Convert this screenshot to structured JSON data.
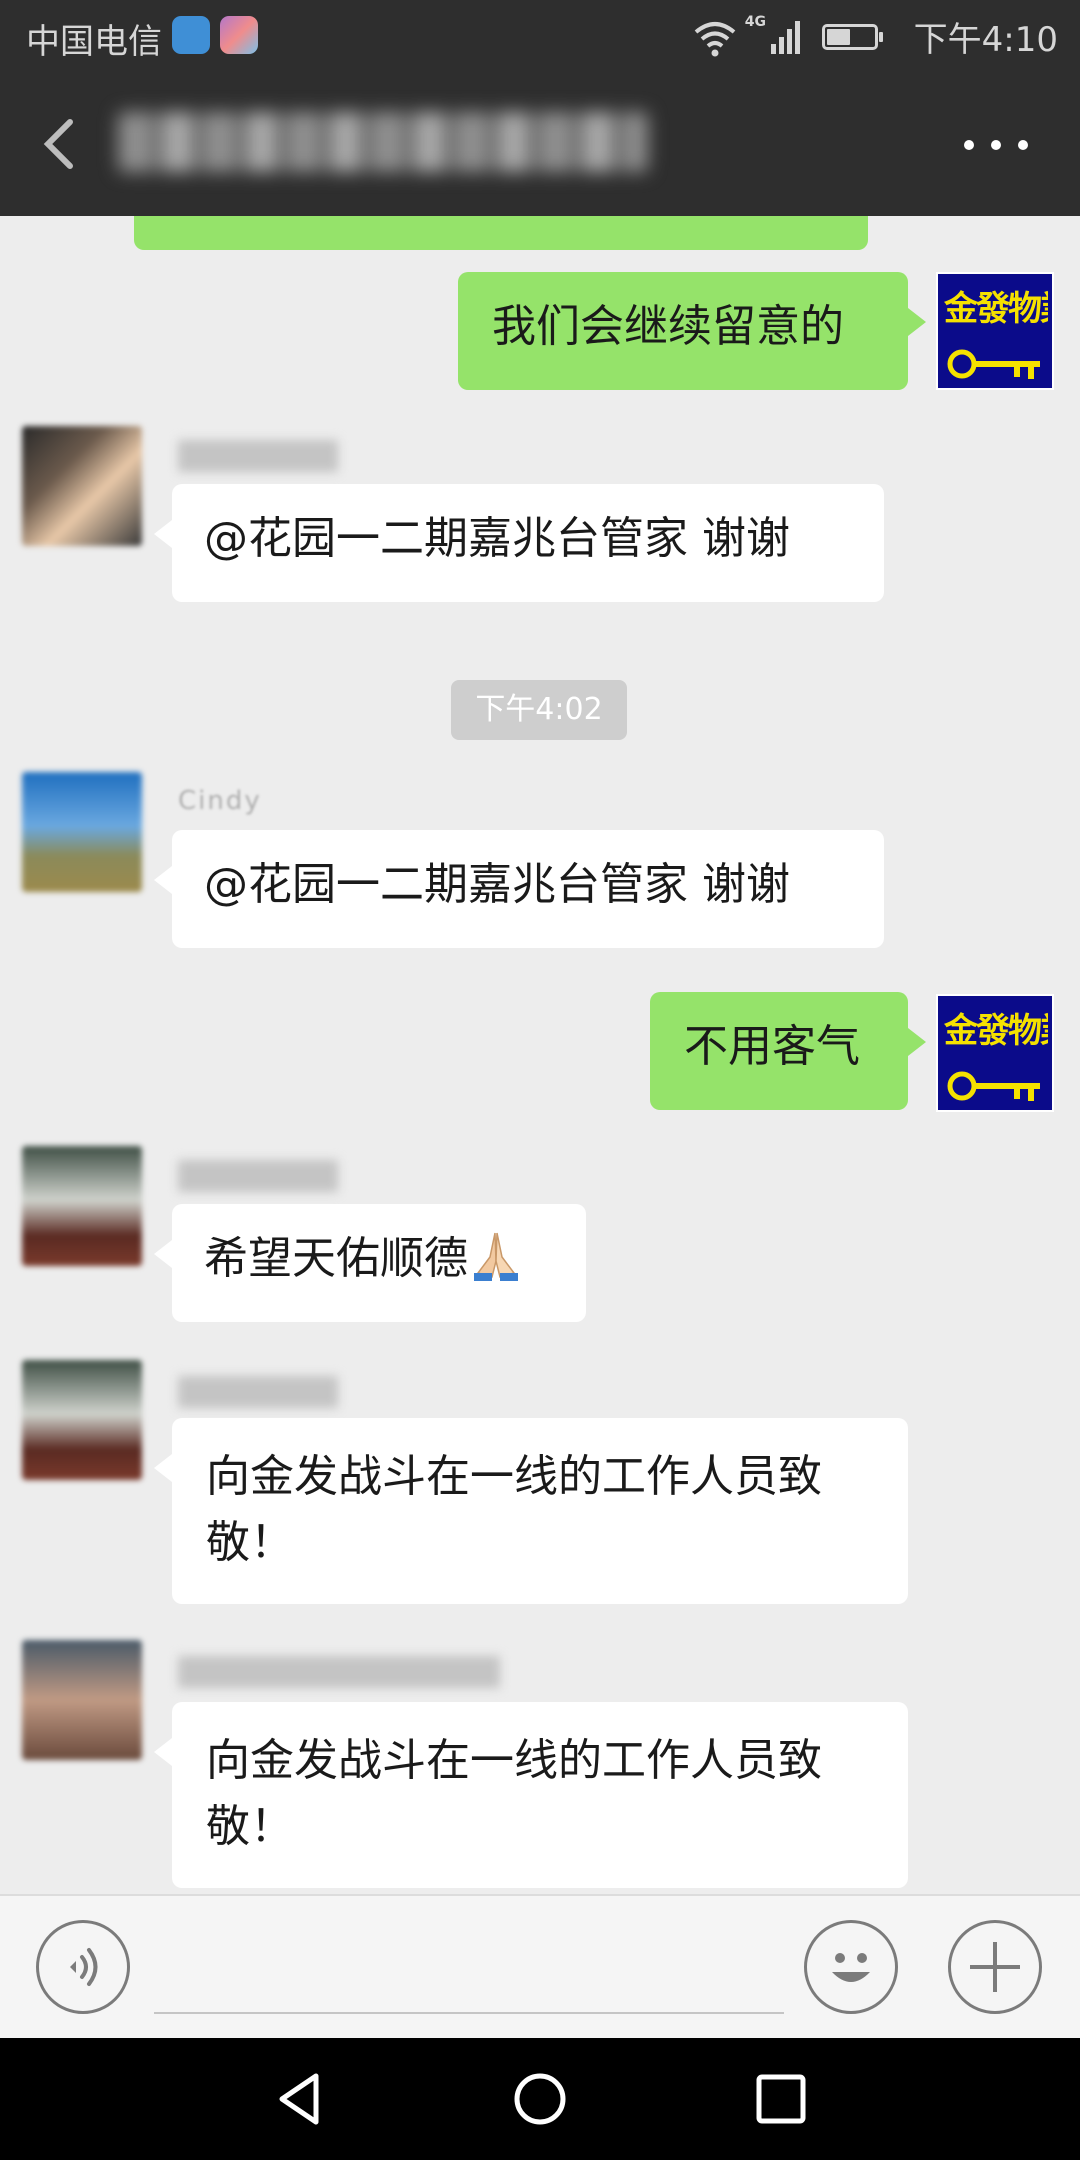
{
  "status_bar": {
    "carrier": "中国电信",
    "network": "4G",
    "time": "下午4:10"
  },
  "header": {
    "chat_title": "",
    "back_icon": "chevron-left-icon",
    "more_icon": "more-dots-icon"
  },
  "messages": [
    {
      "type": "outgoing",
      "text": "我们会继续留意的",
      "avatar": "jinfa-property-logo"
    },
    {
      "type": "incoming",
      "sender": "",
      "text": "@花园一二期嘉兆台管家  谢谢"
    },
    {
      "type": "time",
      "text": "下午4:02"
    },
    {
      "type": "incoming",
      "sender": "Cindy",
      "text": "@花园一二期嘉兆台管家  谢谢"
    },
    {
      "type": "outgoing",
      "text": "不用客气",
      "avatar": "jinfa-property-logo"
    },
    {
      "type": "incoming",
      "sender": "",
      "text": "希望天佑顺德",
      "emoji": "folded-hands"
    },
    {
      "type": "incoming",
      "sender": "",
      "text": "向金发战斗在一线的工作人员致敬！"
    },
    {
      "type": "incoming",
      "sender": "",
      "text": "向金发战斗在一线的工作人员致敬！"
    }
  ],
  "brand_avatar": {
    "text": "金發物業"
  },
  "input_bar": {
    "voice_icon": "voice-icon",
    "emoji_icon": "smiley-icon",
    "plus_icon": "plus-icon",
    "placeholder": ""
  },
  "colors": {
    "header_bg": "#2e2e2e",
    "chat_bg": "#ededed",
    "outgoing_bubble": "#95e36a",
    "incoming_bubble": "#ffffff",
    "brand_blue": "#0b0b8a",
    "brand_yellow": "#f5e100"
  }
}
